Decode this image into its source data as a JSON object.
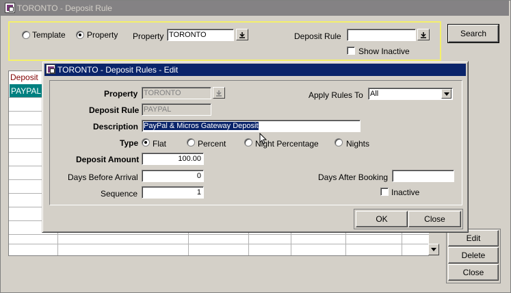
{
  "main": {
    "title": "TORONTO - Deposit Rule",
    "filter": {
      "template_label": "Template",
      "property_radio_label": "Property",
      "property_label": "Property",
      "property_value": "TORONTO",
      "deposit_rule_label": "Deposit Rule",
      "deposit_rule_value": "",
      "show_inactive_label": "Show Inactive"
    },
    "grid": {
      "header": "Deposit",
      "rows": [
        "PAYPAL"
      ]
    },
    "buttons": {
      "search": "Search",
      "edit": "Edit",
      "delete": "Delete",
      "close": "Close"
    }
  },
  "dialog": {
    "title": "TORONTO - Deposit Rules - Edit",
    "property_label": "Property",
    "property_value": "TORONTO",
    "apply_rules_label": "Apply Rules To",
    "apply_rules_value": "All",
    "deposit_rule_label": "Deposit Rule",
    "deposit_rule_value": "PAYPAL",
    "description_label": "Description",
    "description_value": "PayPal & Micros Gateway Deposit",
    "type_label": "Type",
    "type_options": [
      "Flat",
      "Percent",
      "Night Percentage",
      "Nights"
    ],
    "type_selected": "Flat",
    "deposit_amount_label": "Deposit Amount",
    "deposit_amount_value": "100.00",
    "days_before_label": "Days Before Arrival",
    "days_before_value": "0",
    "days_after_label": "Days After Booking",
    "days_after_value": "",
    "sequence_label": "Sequence",
    "sequence_value": "1",
    "inactive_label": "Inactive",
    "ok_label": "OK",
    "close_label": "Close"
  },
  "icons": [
    "app-icon",
    "lov-down-arrow-icon",
    "dropdown-arrow-icon",
    "scroll-down-arrow-icon",
    "mouse-cursor-icon"
  ],
  "colors": {
    "dialog_title": "#0a246a",
    "selected_row": "#008080",
    "filter_border": "#f4f06a",
    "grid_header_text": "#800000"
  }
}
